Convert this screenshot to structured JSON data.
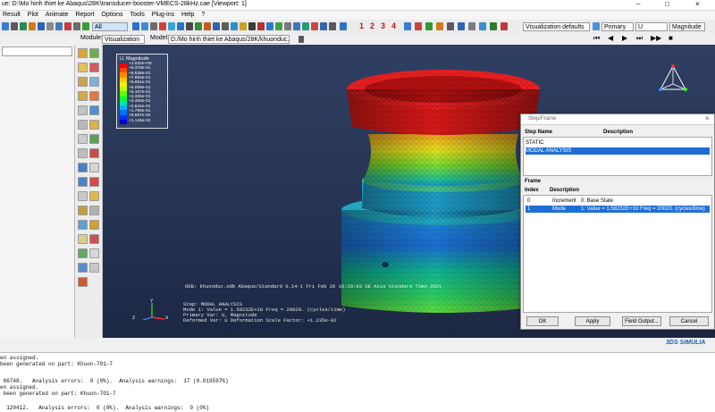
{
  "window": {
    "title": "ue: D:\\Mo hinh thiet ke Abaqus\\28K\\transducer-booster-VMECS-28kHz.cae [Viewport: 1]",
    "minimize": "–",
    "maximize": "□",
    "close": "×"
  },
  "menu": [
    "Result",
    "Plot",
    "Animate",
    "Report",
    "Options",
    "Tools",
    "Plug-ins",
    "Help",
    "?"
  ],
  "toolbar": {
    "filter_value": "All",
    "step_numbers": [
      "1",
      "2",
      "3",
      "4"
    ],
    "visualization_defaults": "Visualization defaults",
    "primary": "Primary",
    "variable": "U",
    "invariant": "Magnitude"
  },
  "context": {
    "module_label": "Module:",
    "module_value": "Visualization",
    "model_label": "Model:",
    "model_value": "D:/Mo hinh thiet ke Abaqus/28K/khuonduc.odb"
  },
  "legend": {
    "title": "U, Magnitude",
    "values": [
      "+1.022e+00",
      "+9.378e-01",
      "+8.536e-01",
      "+7.694e-01",
      "+6.851e-01",
      "+6.009e-01",
      "+5.167e-01",
      "+4.325e-01",
      "+3.483e-01",
      "+2.641e-01",
      "+1.799e-01",
      "+9.567e-02",
      "+1.146e-02"
    ],
    "colors": [
      "#ff0000",
      "#ff4800",
      "#ff8c00",
      "#ffc800",
      "#f0f000",
      "#b4ff00",
      "#60ff00",
      "#00ff40",
      "#00e6b4",
      "#00b4ff",
      "#0070ff",
      "#0030ff",
      "#0000d0"
    ]
  },
  "viewport": {
    "odb_line": "ODB: khuonduc.odb     Abaqus/Standard 6.14-1     Fri Feb 26 16:28:03 SE Asia Standard Time 2021",
    "step_line": "Step: MODAL ANALYSIS",
    "mode_line": "Mode      1: Value = 1.58232E+10 Freq =    20020.    (cycles/time)",
    "primary_line": "Primary Var: U, Magnitude",
    "deformed_line": "Deformed Var: U   Deformation Scale Factor: +1.235e-02",
    "triad_x": "X",
    "triad_y": "Y",
    "triad_z": "Z"
  },
  "dialog": {
    "title": "Step/Frame",
    "close": "×",
    "step_name_header": "Step Name",
    "description_header": "Description",
    "steps": [
      {
        "name": "STATIC",
        "description": ""
      },
      {
        "name": "MODAL ANALYSIS",
        "description": ""
      }
    ],
    "frame_label": "Frame",
    "index_header": "Index",
    "frame_desc_header": "Description",
    "frames": [
      {
        "index": "0",
        "type": "Increment",
        "description": "0: Base State"
      },
      {
        "index": "1",
        "type": "Mode",
        "description": "1: Value = 1.58232E+10 Freq =   20020.    (cycles/time)"
      }
    ],
    "buttons": [
      "OK",
      "Apply",
      "Field Output...",
      "Cancel"
    ]
  },
  "brand": "3DS SIMULIA",
  "messages": [
    "en assigned.",
    "been generated on part: Khuon-701-7",
    "",
    " 86748.   Analysis errors:  0 (0%).  Analysis warnings:  17 (0.019597%)",
    "en assigned.",
    " been generated on part: Khuon-701-7",
    "",
    "  120412.   Analysis errors:  0 (0%).  Analysis warnings:  0 (0%)"
  ]
}
